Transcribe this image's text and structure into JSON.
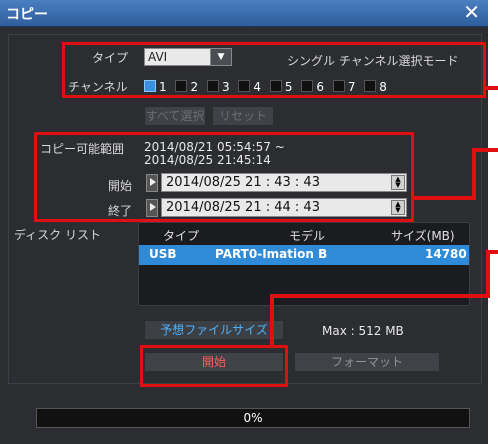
{
  "window": {
    "title": "コピー",
    "close": "✕"
  },
  "type": {
    "label": "タイプ",
    "value": "AVI",
    "mode_text": "シングル チャンネル選択モード"
  },
  "channels": {
    "label": "チャンネル",
    "items": [
      {
        "num": "1",
        "checked": true
      },
      {
        "num": "2",
        "checked": false
      },
      {
        "num": "3",
        "checked": false
      },
      {
        "num": "4",
        "checked": false
      },
      {
        "num": "5",
        "checked": false
      },
      {
        "num": "6",
        "checked": false
      },
      {
        "num": "7",
        "checked": false
      },
      {
        "num": "8",
        "checked": false
      }
    ]
  },
  "buttons": {
    "select_all": "すべて選択",
    "reset": "リセット",
    "estimate": "予想ファイルサイズ",
    "start": "開始",
    "format": "フォーマット"
  },
  "range": {
    "label": "コピー可能範囲",
    "line1": "2014/08/21  05:54:57 ~",
    "line2": "2014/08/25  21:45:14",
    "start_label": "開始",
    "start_value": "2014/08/25  21 : 43 : 43",
    "end_label": "終了",
    "end_value": "2014/08/25  21 : 44 : 43"
  },
  "disk": {
    "label": "ディスク リスト",
    "columns": [
      "タイプ",
      "モデル",
      "サイズ(MB)"
    ],
    "rows": [
      {
        "type": "USB",
        "model": "PART0-Imation B",
        "size": "14780"
      }
    ]
  },
  "max": "Max : 512 MB",
  "progress": {
    "value": 0,
    "text": "0%"
  }
}
